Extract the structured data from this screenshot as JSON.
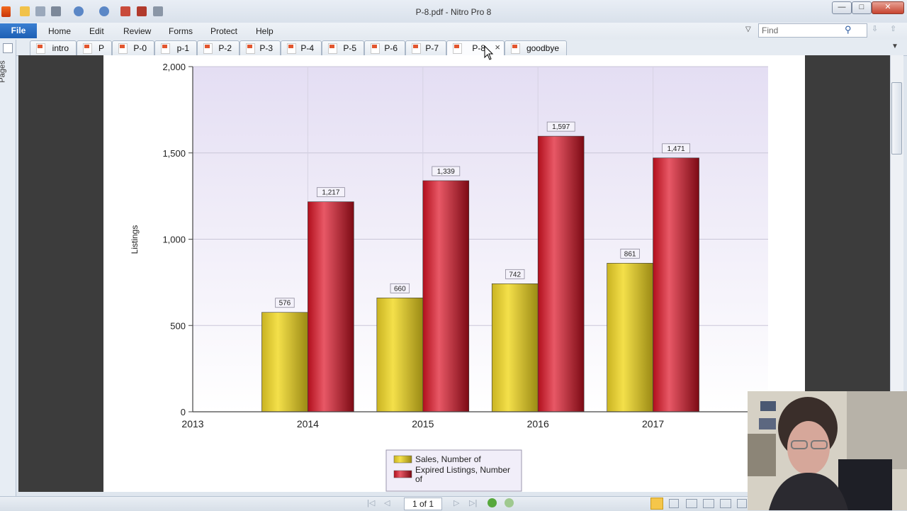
{
  "window": {
    "title": "P-8.pdf - Nitro Pro 8",
    "minimize": "—",
    "maximize": "□",
    "close": "✕"
  },
  "ribbon": {
    "file": "File",
    "tabs": [
      "Home",
      "Edit",
      "Review",
      "Forms",
      "Protect",
      "Help"
    ],
    "find_placeholder": "Find"
  },
  "doc_tabs": [
    "intro",
    "P",
    "P-0",
    "p-1",
    "P-2",
    "P-3",
    "P-4",
    "P-5",
    "P-6",
    "P-7",
    "P-8",
    "goodbye"
  ],
  "active_tab": "P-8",
  "side_panel": {
    "pages_label": "Pages"
  },
  "status": {
    "page_indicator": "1 of 1"
  },
  "colors": {
    "sales": "#e8d22a",
    "expired": "#c3101f",
    "plot_bg": "#ece9f6",
    "accent": "#1d5fb4"
  },
  "chart_data": {
    "type": "bar",
    "categories": [
      "2014",
      "2015",
      "2016",
      "2017"
    ],
    "x_ticks": [
      "2013",
      "2014",
      "2015",
      "2016",
      "2017"
    ],
    "series": [
      {
        "name": "Sales, Number of",
        "values": [
          576,
          660,
          742,
          861
        ],
        "labels": [
          "576",
          "660",
          "742",
          "861"
        ]
      },
      {
        "name": "Expired Listings, Number of",
        "values": [
          1217,
          1339,
          1597,
          1471
        ],
        "labels": [
          "1,217",
          "1,339",
          "1,597",
          "1,471"
        ]
      }
    ],
    "ylabel": "Listings",
    "ylim": [
      0,
      2000
    ],
    "y_ticks": [
      "0",
      "500",
      "1,000",
      "1,500",
      "2,000"
    ],
    "grid": true,
    "legend_position": "bottom"
  }
}
